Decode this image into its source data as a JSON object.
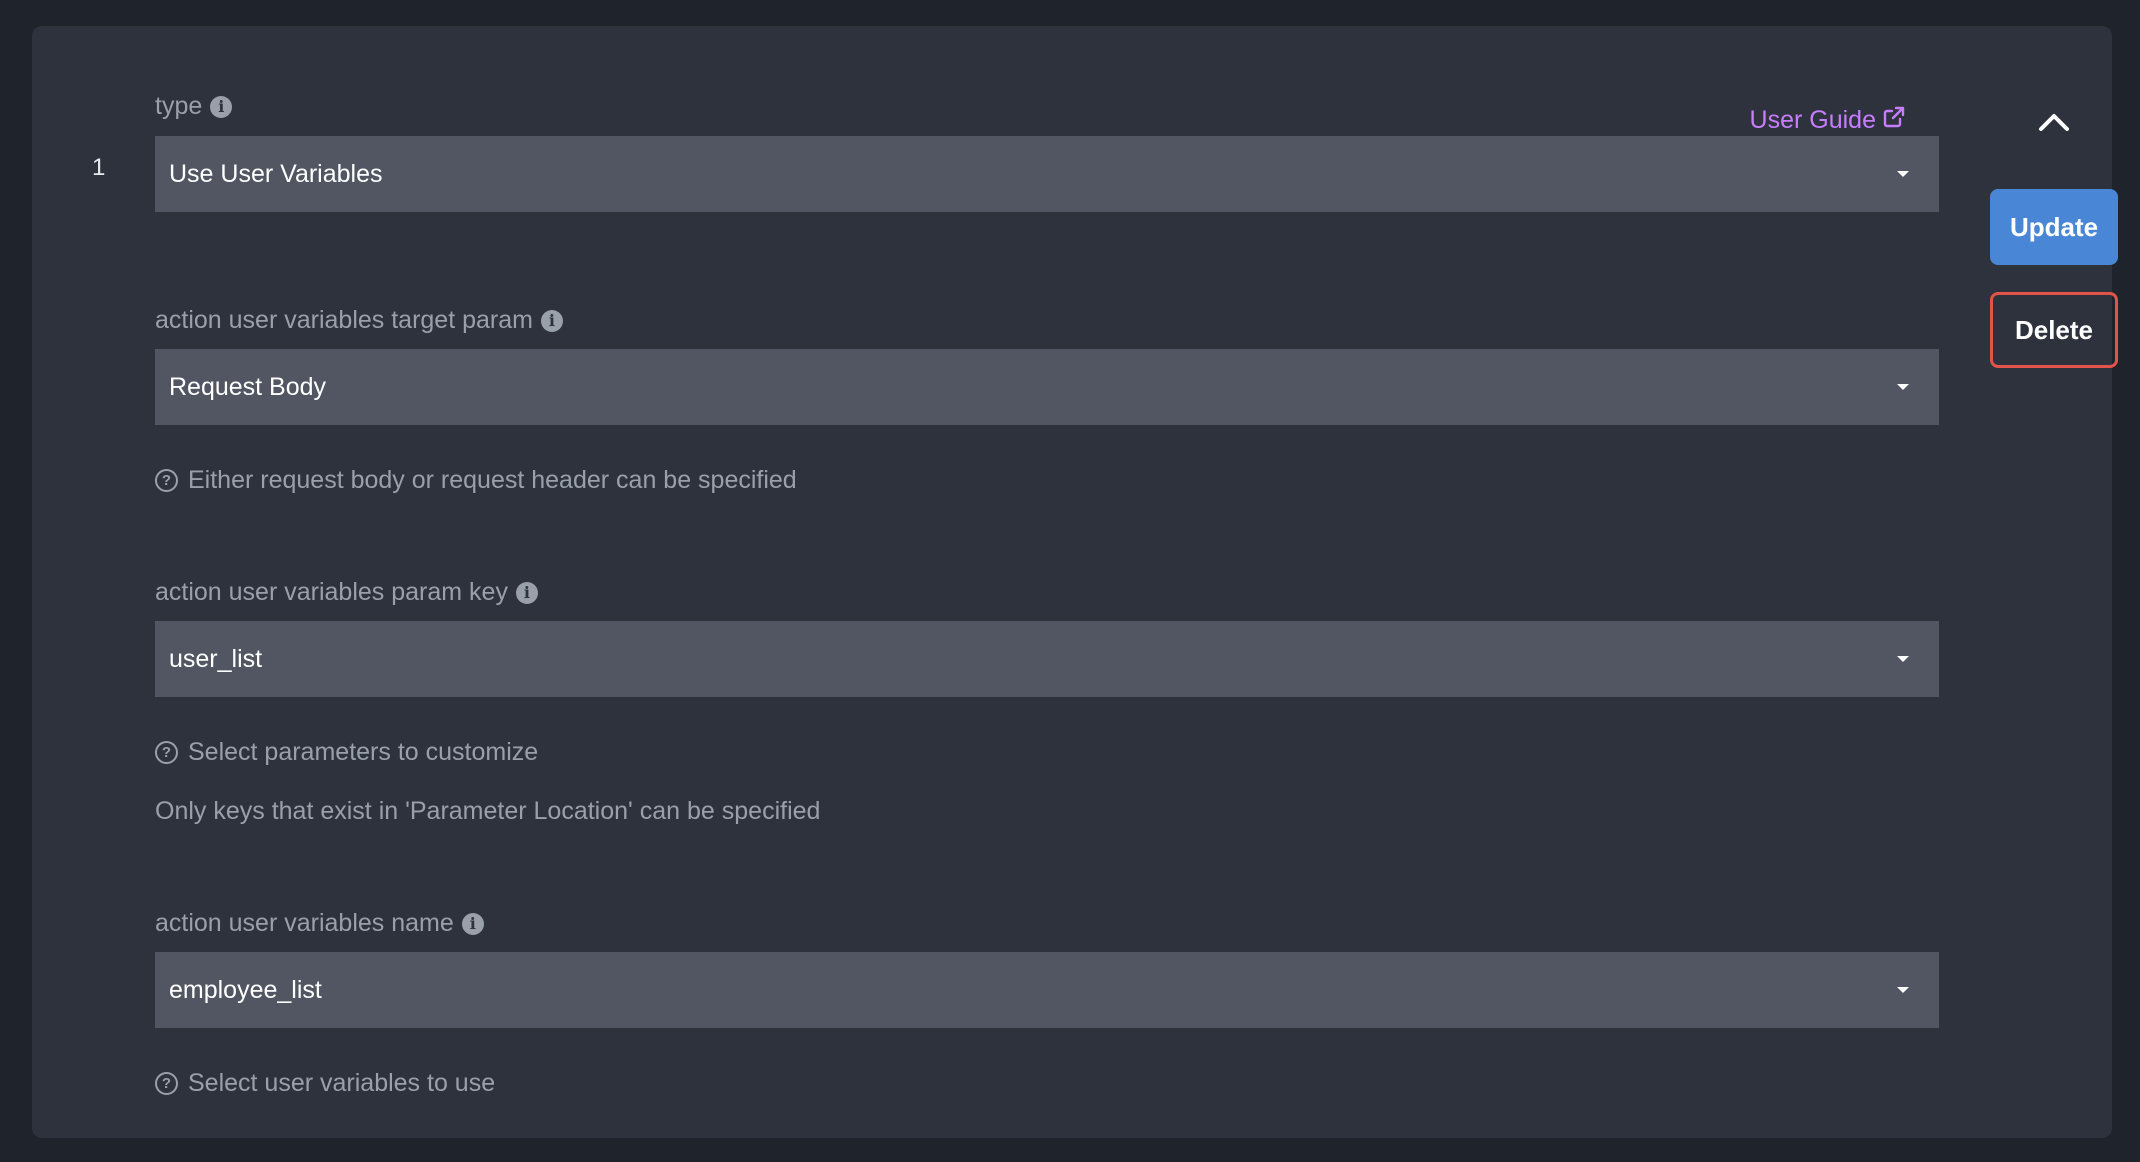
{
  "item": {
    "index": "1"
  },
  "header": {
    "user_guide_label": "User Guide",
    "collapse_icon": "chevron-up-icon"
  },
  "actions": {
    "update_label": "Update",
    "delete_label": "Delete"
  },
  "fields": {
    "type": {
      "label": "type",
      "value": "Use User Variables"
    },
    "target_param": {
      "label": "action user variables target param",
      "value": "Request Body",
      "help": "Either request body or request header can be specified"
    },
    "param_key": {
      "label": "action user variables param key",
      "value": "user_list",
      "help": "Select parameters to customize",
      "note": "Only keys that exist in 'Parameter Location' can be specified"
    },
    "variables_name": {
      "label": "action user variables name",
      "value": "employee_list",
      "help": "Select user variables to use"
    }
  },
  "colors": {
    "page_bg": "#1f232b",
    "card_bg": "#2e323c",
    "select_bg": "#515662",
    "muted_text": "#9aa0aa",
    "link": "#c77dff",
    "primary_button": "#4a86d6",
    "danger_border": "#e0544a"
  }
}
